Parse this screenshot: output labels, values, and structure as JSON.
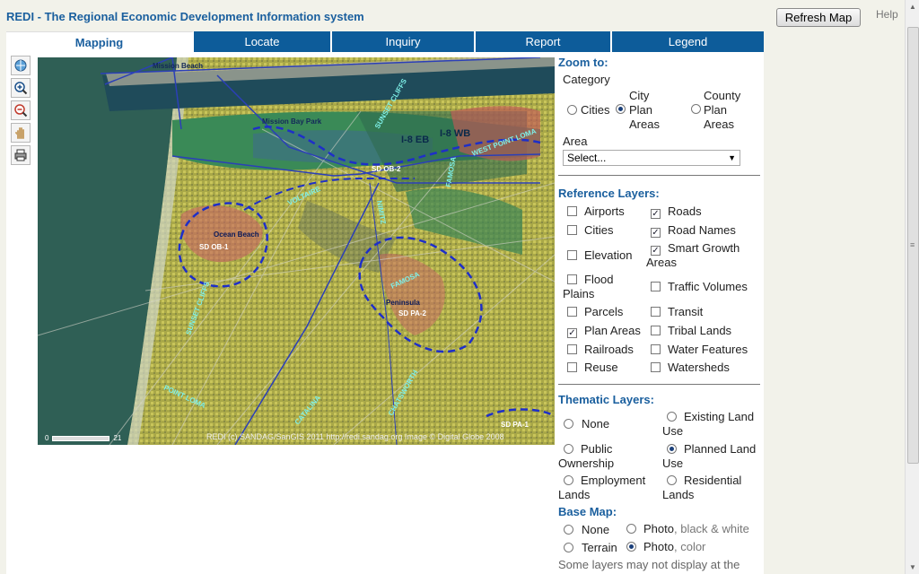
{
  "app": {
    "title": "REDI - The Regional Economic Development Information system",
    "refresh_label": "Refresh Map",
    "help_label": "Help"
  },
  "tabs": [
    {
      "label": "Mapping",
      "active": true
    },
    {
      "label": "Locate"
    },
    {
      "label": "Inquiry"
    },
    {
      "label": "Report"
    },
    {
      "label": "Legend"
    }
  ],
  "toolbar": [
    "globe-icon",
    "zoom-in-icon",
    "zoom-out-icon",
    "pan-hand-icon",
    "print-icon"
  ],
  "map": {
    "labels": {
      "mission_beach": "Mission Beach",
      "mission_bay_park": "Mission Bay Park",
      "sunset_cliffs_top": "SUNSET CLIFFS",
      "i8eb": "I-8 EB",
      "i8wb": "I-8 WB",
      "west_point_loma": "WEST POINT LOMA",
      "sd_ob2": "SD OB-2",
      "famosa_top": "FAMOSA",
      "voltaire": "VOLTAIRE",
      "nimitz": "NIMITZ",
      "ocean_beach": "Ocean Beach",
      "sd_ob1": "SD OB-1",
      "famosa": "FAMOSA",
      "peninsula": "Peninsula",
      "sd_pa2": "SD PA-2",
      "sunset_cliffs": "SUNSET CLIFFS",
      "point_loma": "POINT LOMA",
      "catalina": "CATALINA",
      "chatsworth": "CHATSWORTH",
      "sd_pa1": "SD PA-1"
    },
    "credit": "REDI (c) SANDAG/SanGIS 2011   http://redi.sandag.org   Image © Digital Globe 2008",
    "scale_start": "0",
    "scale_end": "21"
  },
  "panel": {
    "zoom_to": "Zoom to:",
    "category": "Category",
    "category_options": [
      "Cities",
      "City Plan Areas",
      "County Plan Areas"
    ],
    "area": "Area",
    "area_value": "Select...",
    "reference_layers": "Reference Layers:",
    "layers_left": [
      {
        "label": "Airports",
        "checked": false
      },
      {
        "label": "Cities",
        "checked": false
      },
      {
        "label": "Elevation",
        "checked": false
      },
      {
        "label": "Flood Plains",
        "checked": false
      },
      {
        "label": "Parcels",
        "checked": false
      },
      {
        "label": "Plan Areas",
        "checked": true
      },
      {
        "label": "Railroads",
        "checked": false
      },
      {
        "label": "Reuse",
        "checked": false
      }
    ],
    "layers_right": [
      {
        "label": "Roads",
        "checked": true
      },
      {
        "label": "Road Names",
        "checked": true
      },
      {
        "label": "Smart Growth Areas",
        "checked": true
      },
      {
        "label": "Traffic Volumes",
        "checked": false
      },
      {
        "label": "Transit",
        "checked": false
      },
      {
        "label": "Tribal Lands",
        "checked": false
      },
      {
        "label": "Water Features",
        "checked": false
      },
      {
        "label": "Watersheds",
        "checked": false
      }
    ],
    "thematic_layers": "Thematic Layers:",
    "thematic_options": [
      "None",
      "Existing Land Use",
      "Public Ownership",
      "Planned Land Use",
      "Employment Lands",
      "Residential Lands"
    ],
    "thematic_selected": "Planned Land Use",
    "base_map": "Base Map:",
    "base_none": "None",
    "base_terrain": "Terrain",
    "base_photo": "Photo",
    "base_bw": ", black & white",
    "base_color": ", color",
    "base_selected": "Photo, color",
    "note": "Some layers may not display at the"
  }
}
